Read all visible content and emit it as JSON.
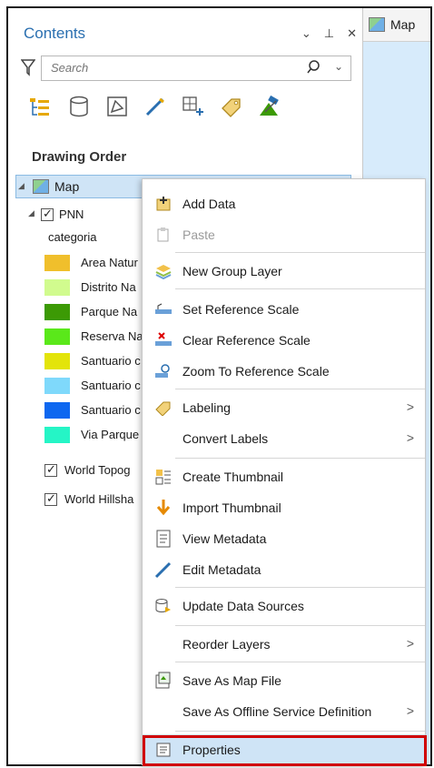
{
  "contents_pane": {
    "title": "Contents",
    "controls": [
      "⌄",
      "⊥",
      "✕"
    ],
    "search": {
      "placeholder": "Search",
      "value": ""
    },
    "toolbar_icons": [
      "list-by-drawing-order-icon",
      "list-by-data-source-icon",
      "list-by-selection-icon",
      "list-by-editing-icon",
      "list-by-snapping-icon",
      "list-by-labeling-icon",
      "list-by-perspective-imagery-icon"
    ],
    "section_heading": "Drawing Order",
    "map_node": {
      "label": "Map"
    },
    "layer_pnn": {
      "label": "PNN",
      "field": "categoria"
    },
    "legend": [
      {
        "label": "Area Natur",
        "color": "#f0bf2c"
      },
      {
        "label": "Distrito Na",
        "color": "#d1fb8e"
      },
      {
        "label": "Parque Na",
        "color": "#3c9a05"
      },
      {
        "label": "Reserva Na",
        "color": "#5ae81a"
      },
      {
        "label": "Santuario c",
        "color": "#e3e40a"
      },
      {
        "label": "Santuario c",
        "color": "#7fd9fb"
      },
      {
        "label": "Santuario c",
        "color": "#0d67f0"
      },
      {
        "label": "Via Parque",
        "color": "#25f5c6"
      }
    ],
    "basemap_layers": [
      "World Topog",
      "World Hillsha"
    ]
  },
  "map_tab": {
    "label": "Map"
  },
  "context_menu": {
    "items": [
      {
        "label": "Add Data",
        "icon": "add-data-icon",
        "disabled": false
      },
      {
        "label": "Paste",
        "icon": "paste-icon",
        "disabled": true
      },
      {
        "label": "New Group Layer",
        "icon": "group-layer-icon",
        "disabled": false
      },
      {
        "label": "Set Reference Scale",
        "icon": "set-scale-icon",
        "disabled": false
      },
      {
        "label": "Clear Reference Scale",
        "icon": "clear-scale-icon",
        "disabled": false
      },
      {
        "label": "Zoom To Reference Scale",
        "icon": "zoom-scale-icon",
        "disabled": false
      },
      {
        "label": "Labeling",
        "icon": "labeling-icon",
        "submenu": true
      },
      {
        "label": "Convert Labels",
        "icon": "",
        "submenu": true
      },
      {
        "label": "Create Thumbnail",
        "icon": "create-thumbnail-icon",
        "disabled": false
      },
      {
        "label": "Import Thumbnail",
        "icon": "import-thumbnail-icon",
        "disabled": false
      },
      {
        "label": "View Metadata",
        "icon": "view-metadata-icon",
        "disabled": false
      },
      {
        "label": "Edit Metadata",
        "icon": "edit-metadata-icon",
        "disabled": false
      },
      {
        "label": "Update Data Sources",
        "icon": "update-sources-icon",
        "disabled": false
      },
      {
        "label": "Reorder Layers",
        "icon": "",
        "submenu": true
      },
      {
        "label": "Save As Map File",
        "icon": "save-map-file-icon",
        "disabled": false
      },
      {
        "label": "Save As Offline Service Definition",
        "icon": "",
        "submenu": true
      },
      {
        "label": "Properties",
        "icon": "properties-icon",
        "disabled": false
      }
    ],
    "submenu_glyph": ">"
  },
  "colors": {
    "accent": "#2a6fb0",
    "selection": "#cfe4f6",
    "highlight_border": "#d00000"
  }
}
